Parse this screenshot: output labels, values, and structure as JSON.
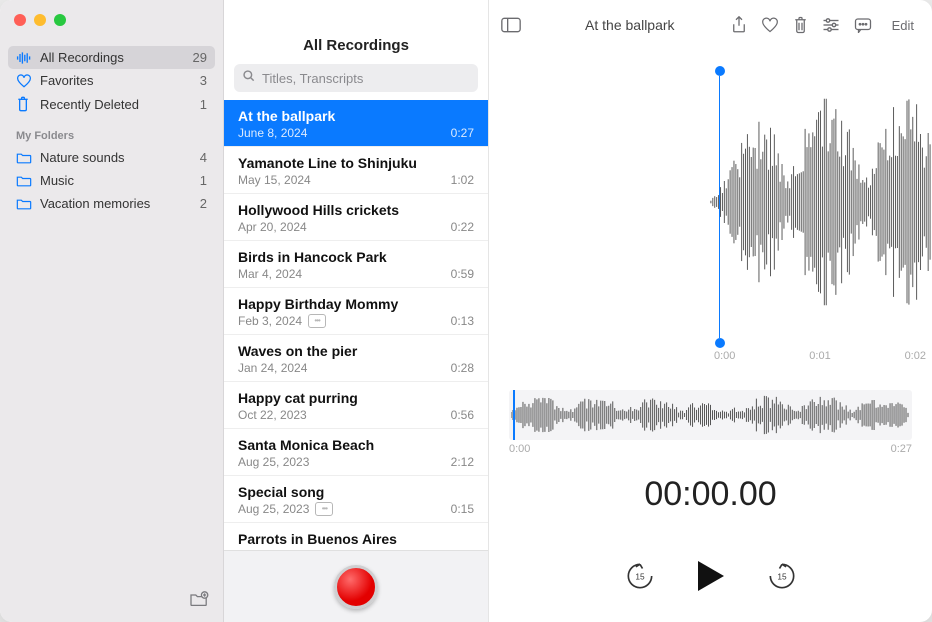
{
  "toolbar": {
    "title": "At the ballpark",
    "edit_label": "Edit"
  },
  "sidebar": {
    "items": [
      {
        "icon": "waveform",
        "label": "All Recordings",
        "count": 29,
        "selected": true
      },
      {
        "icon": "heart",
        "label": "Favorites",
        "count": 3
      },
      {
        "icon": "trash",
        "label": "Recently Deleted",
        "count": 1
      }
    ],
    "folders_heading": "My Folders",
    "folders": [
      {
        "label": "Nature sounds",
        "count": 4
      },
      {
        "label": "Music",
        "count": 1
      },
      {
        "label": "Vacation memories",
        "count": 2
      }
    ]
  },
  "middle": {
    "header": "All Recordings",
    "search_placeholder": "Titles, Transcripts",
    "recordings": [
      {
        "title": "At the ballpark",
        "date": "June 8, 2024",
        "duration": "0:27",
        "selected": true
      },
      {
        "title": "Yamanote Line to Shinjuku",
        "date": "May 15, 2024",
        "duration": "1:02"
      },
      {
        "title": "Hollywood Hills crickets",
        "date": "Apr 20, 2024",
        "duration": "0:22"
      },
      {
        "title": "Birds in Hancock Park",
        "date": "Mar 4, 2024",
        "duration": "0:59"
      },
      {
        "title": "Happy Birthday Mommy",
        "date": "Feb 3, 2024",
        "duration": "0:13",
        "transcript": true
      },
      {
        "title": "Waves on the pier",
        "date": "Jan 24, 2024",
        "duration": "0:28"
      },
      {
        "title": "Happy cat purring",
        "date": "Oct 22, 2023",
        "duration": "0:56"
      },
      {
        "title": "Santa Monica Beach",
        "date": "Aug 25, 2023",
        "duration": "2:12"
      },
      {
        "title": "Special song",
        "date": "Aug 25, 2023",
        "duration": "0:15",
        "transcript": true
      },
      {
        "title": "Parrots in Buenos Aires",
        "date": "",
        "duration": ""
      }
    ]
  },
  "player": {
    "big_axis": [
      "0:00",
      "0:01",
      "0:02"
    ],
    "mini_start": "0:00",
    "mini_end": "0:27",
    "timer": "00:00.00",
    "skip_seconds": "15"
  }
}
